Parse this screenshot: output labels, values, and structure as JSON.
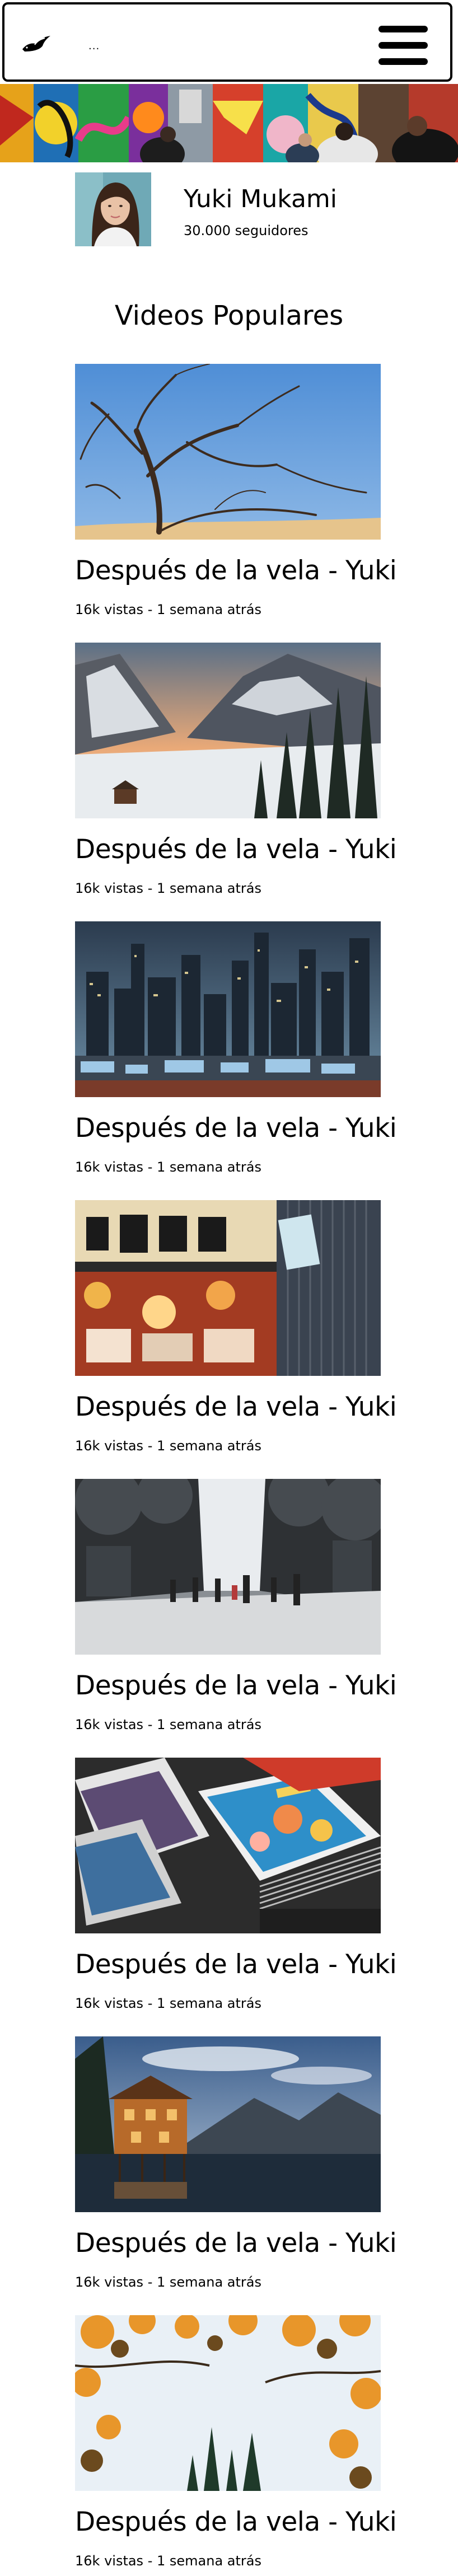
{
  "header": {
    "logo_icon": "bird-logo-icon",
    "dots": "...",
    "menu_icon": "hamburger-menu-icon"
  },
  "profile": {
    "name": "Yuki Mukami",
    "followers": "30.000 seguidores"
  },
  "section_title": "Videos Populares",
  "videos": [
    {
      "title": "Después de la vela - Yuki",
      "meta": "16k vistas - 1 semana atrás"
    },
    {
      "title": "Después de la vela - Yuki",
      "meta": "16k vistas - 1 semana atrás"
    },
    {
      "title": "Después de la vela - Yuki",
      "meta": "16k vistas - 1 semana atrás"
    },
    {
      "title": "Después de la vela - Yuki",
      "meta": "16k vistas - 1 semana atrás"
    },
    {
      "title": "Después de la vela - Yuki",
      "meta": "16k vistas - 1 semana atrás"
    },
    {
      "title": "Después de la vela - Yuki",
      "meta": "16k vistas - 1 semana atrás"
    },
    {
      "title": "Después de la vela - Yuki",
      "meta": "16k vistas - 1 semana atrás"
    },
    {
      "title": "Después de la vela - Yuki",
      "meta": "16k vistas - 1 semana atrás"
    }
  ]
}
